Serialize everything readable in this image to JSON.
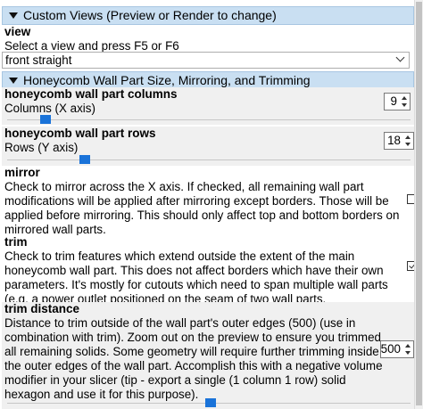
{
  "sections": {
    "custom_views": {
      "title": "Custom Views (Preview or Render to change)"
    },
    "honeycomb": {
      "title": "Honeycomb Wall Part Size, Mirroring, and Trimming"
    }
  },
  "view": {
    "name": "view",
    "description": "Select a view and press F5 or F6",
    "selected": "front straight"
  },
  "columns": {
    "name": "honeycomb wall part columns",
    "description": "Columns (X axis)",
    "value": "9",
    "slider_fraction": 0.085
  },
  "rows": {
    "name": "honeycomb wall part rows",
    "description": "Rows (Y axis)",
    "value": "18",
    "slider_fraction": 0.185
  },
  "mirror": {
    "name": "mirror",
    "description_lines": [
      "Check to mirror across the X axis. If checked, all remaining wall part",
      "modifications will be applied after mirroring except borders. Those will be",
      "applied before mirroring. This should only affect top and bottom borders on",
      "mirrored wall parts."
    ],
    "checked": false
  },
  "trim": {
    "name": "trim",
    "description_lines": [
      "Check to trim features which extend outside the extent of the main",
      "honeycomb wall part. This does not affect borders which have their own",
      "parameters. It's mostly for cutouts which need to span multiple wall parts",
      "(e.g. a power outlet positioned on the seam of two wall parts."
    ],
    "checked": true
  },
  "trim_distance": {
    "name": "trim distance",
    "description_lines": [
      "Distance to trim outside of the wall part's outer edges (500) (use in",
      "combination with trim). Zoom out on the preview to ensure you trimmed",
      "all remaining solids. Some geometry will require further trimming inside",
      "the outer edges of the wall part. Accomplish this with a negative volume",
      "modifier in your slicer (tip - export a single (1 column 1 row) solid",
      "hexagon and use it for this purpose)."
    ],
    "value": "500",
    "slider_fraction": 0.505
  },
  "colors": {
    "header_bg": "#c9dff2",
    "panel_bg": "#f0f0f0",
    "slider_thumb": "#1a73d9"
  }
}
